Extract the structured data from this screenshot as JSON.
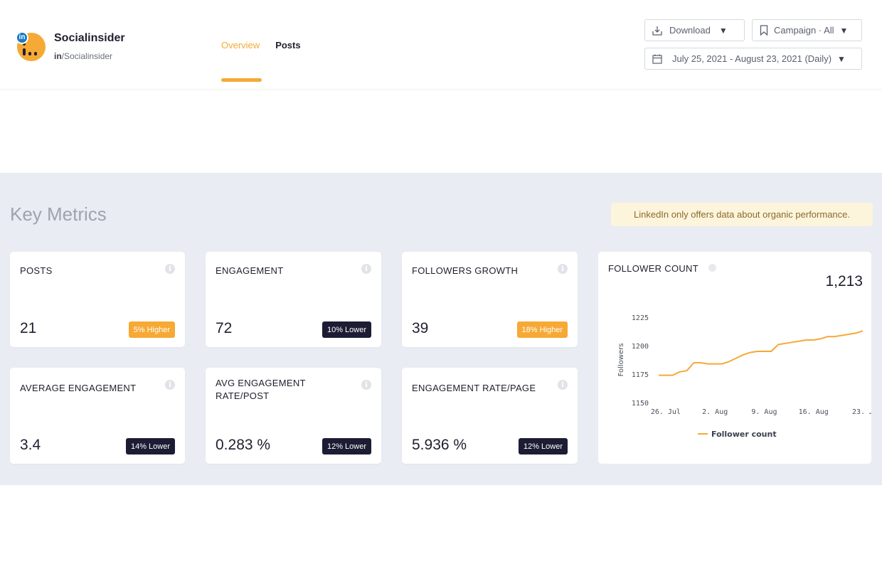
{
  "header": {
    "brand_name": "Socialinsider",
    "handle_prefix": "in",
    "handle_suffix": "/Socialinsider",
    "li_badge": "in",
    "tabs": [
      {
        "label": "Overview",
        "active": true
      },
      {
        "label": "Posts",
        "active": false
      }
    ],
    "download_label": "Download",
    "campaign_label": "Campaign · All",
    "date_range_label": "July 25, 2021 - August 23, 2021 (Daily)",
    "caret": "▼"
  },
  "section": {
    "title": "Key Metrics",
    "notice": "LinkedIn only offers data about organic performance."
  },
  "info_glyph": "i",
  "metrics": [
    {
      "title": "POSTS",
      "value": "21",
      "badge": "5% Higher",
      "trend": "higher"
    },
    {
      "title": "ENGAGEMENT",
      "value": "72",
      "badge": "10% Lower",
      "trend": "lower"
    },
    {
      "title": "FOLLOWERS GROWTH",
      "value": "39",
      "badge": "18% Higher",
      "trend": "higher"
    },
    {
      "title": "AVERAGE ENGAGEMENT",
      "value": "3.4",
      "badge": "14% Lower",
      "trend": "lower"
    },
    {
      "title": "AVG ENGAGEMENT RATE/POST",
      "value": "0.283 %",
      "badge": "12% Lower",
      "trend": "lower"
    },
    {
      "title": "ENGAGEMENT RATE/PAGE",
      "value": "5.936 %",
      "badge": "12% Lower",
      "trend": "lower"
    }
  ],
  "colors": {
    "accent": "#f6a935",
    "dark_badge": "#1c1c34",
    "background": "#e9ecf2"
  },
  "chart_data": {
    "type": "line",
    "title": "FOLLOWER COUNT",
    "current_value": "1,213",
    "ylabel": "Followers",
    "xlabel": "",
    "ylim": [
      1150,
      1225
    ],
    "yticks": [
      1225,
      1200,
      1175,
      1150
    ],
    "xtick_labels": [
      "26. Jul",
      "2. Aug",
      "9. Aug",
      "16. Aug",
      "23. …"
    ],
    "xtick_days": [
      1,
      8,
      15,
      22,
      29
    ],
    "legend": "Follower count",
    "legend_position": "bottom-center",
    "grid": false,
    "series": [
      {
        "name": "Follower count",
        "color": "#f6a935",
        "x_days": [
          0,
          1,
          2,
          3,
          4,
          5,
          6,
          7,
          8,
          9,
          10,
          11,
          12,
          13,
          14,
          15,
          16,
          17,
          18,
          19,
          20,
          21,
          22,
          23,
          24,
          25,
          26,
          27,
          28,
          29
        ],
        "values": [
          1174,
          1174,
          1174,
          1177,
          1178,
          1185,
          1185,
          1184,
          1184,
          1184,
          1186,
          1189,
          1192,
          1194,
          1195,
          1195,
          1195,
          1201,
          1202,
          1203,
          1204,
          1205,
          1205,
          1206,
          1208,
          1208,
          1209,
          1210,
          1211,
          1213
        ]
      }
    ]
  }
}
